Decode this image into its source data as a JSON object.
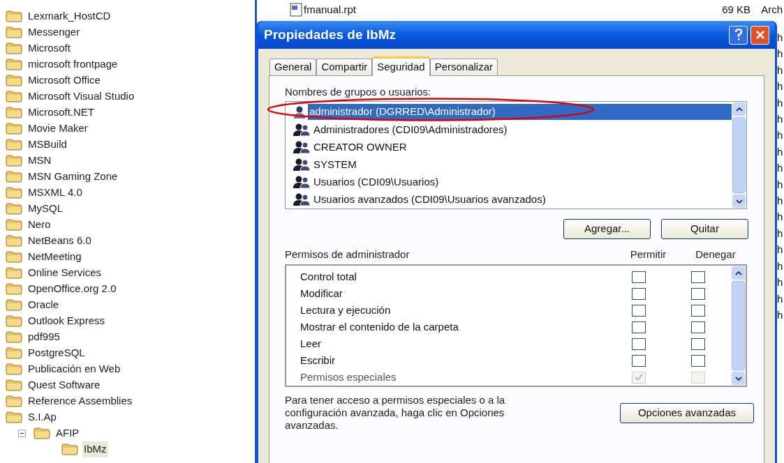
{
  "folder_tree": [
    {
      "label": "Lexmark_HostCD"
    },
    {
      "label": "Messenger"
    },
    {
      "label": "Microsoft"
    },
    {
      "label": "microsoft frontpage"
    },
    {
      "label": "Microsoft Office"
    },
    {
      "label": "Microsoft Visual Studio"
    },
    {
      "label": "Microsoft.NET"
    },
    {
      "label": "Movie Maker"
    },
    {
      "label": "MSBuild"
    },
    {
      "label": "MSN"
    },
    {
      "label": "MSN Gaming Zone"
    },
    {
      "label": "MSXML 4.0"
    },
    {
      "label": "MySQL"
    },
    {
      "label": "Nero"
    },
    {
      "label": "NetBeans 6.0"
    },
    {
      "label": "NetMeeting"
    },
    {
      "label": "Online Services"
    },
    {
      "label": "OpenOffice.org 2.0"
    },
    {
      "label": "Oracle"
    },
    {
      "label": "Outlook Express"
    },
    {
      "label": "pdf995"
    },
    {
      "label": "PostgreSQL"
    },
    {
      "label": "Publicación en Web"
    },
    {
      "label": "Quest Software"
    },
    {
      "label": "Reference Assemblies"
    },
    {
      "label": "S.I.Ap",
      "children": [
        {
          "label": "AFIP",
          "expanded": true,
          "children": [
            {
              "label": "IbMz",
              "selected": true
            }
          ]
        }
      ]
    }
  ],
  "file_list": {
    "row": {
      "name": "fmanual.rpt",
      "size": "69 KB",
      "type": "Arch"
    },
    "type_column_cut": [
      "h",
      "h",
      "h",
      "h",
      "h",
      "h",
      "h",
      "h",
      "h",
      "h",
      "h",
      "h",
      "h",
      "h",
      "h",
      "h",
      "h",
      "h"
    ]
  },
  "dialog": {
    "title": "Propiedades de IbMz",
    "tabs": [
      {
        "label": "General",
        "selected": false
      },
      {
        "label": "Compartir",
        "selected": false
      },
      {
        "label": "Seguridad",
        "selected": true
      },
      {
        "label": "Personalizar",
        "selected": false
      }
    ],
    "users_label": "Nombres de grupos o usuarios:",
    "users": [
      {
        "name": "administrador (DGRRED\\Administrador)",
        "kind": "user",
        "selected": true
      },
      {
        "name": "Administradores (CDI09\\Administradores)",
        "kind": "group",
        "selected": false
      },
      {
        "name": "CREATOR OWNER",
        "kind": "group",
        "selected": false
      },
      {
        "name": "SYSTEM",
        "kind": "group",
        "selected": false
      },
      {
        "name": "Usuarios (CDI09\\Usuarios)",
        "kind": "group",
        "selected": false
      },
      {
        "name": "Usuarios avanzados (CDI09\\Usuarios avanzados)",
        "kind": "group",
        "selected": false
      }
    ],
    "user_buttons": [
      "Agregar...",
      "Quitar"
    ],
    "permissions_label": "Permisos de administrador",
    "permissions_columns": [
      "Permitir",
      "Denegar"
    ],
    "permissions": [
      {
        "name": "Control total",
        "allow": false,
        "deny": false,
        "disabled": false
      },
      {
        "name": "Modificar",
        "allow": false,
        "deny": false,
        "disabled": false
      },
      {
        "name": "Lectura y ejecución",
        "allow": false,
        "deny": false,
        "disabled": false
      },
      {
        "name": "Mostrar el contenido de la carpeta",
        "allow": false,
        "deny": false,
        "disabled": false
      },
      {
        "name": "Leer",
        "allow": false,
        "deny": false,
        "disabled": false
      },
      {
        "name": "Escribir",
        "allow": false,
        "deny": false,
        "disabled": false
      },
      {
        "name": "Permisos especiales",
        "allow": true,
        "deny": false,
        "disabled": true
      }
    ],
    "advanced_text": "Para tener acceso a permisos especiales o a la configuración avanzada, haga clic en Opciones avanzadas.",
    "advanced_button": "Opciones avanzadas"
  }
}
